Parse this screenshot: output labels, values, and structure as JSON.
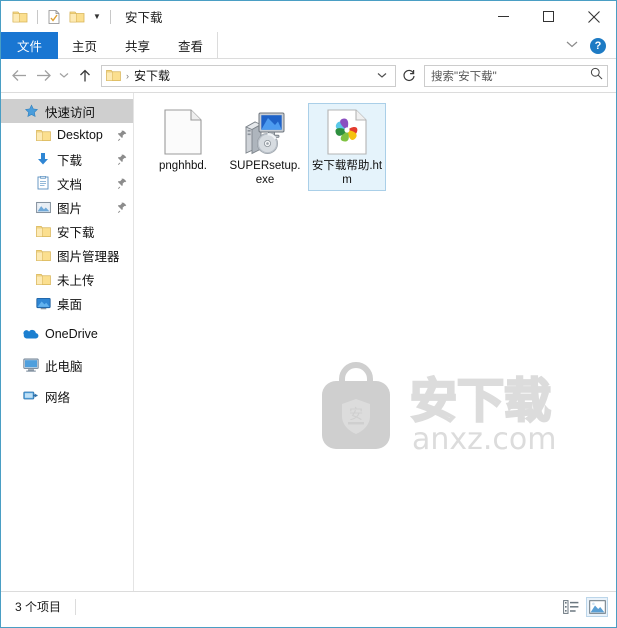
{
  "window": {
    "title": "安下载",
    "accent_blue": "#1976d2",
    "border_color": "#4a9ec4",
    "selection_bg": "#e5f3fb",
    "selection_border": "#aacfe8"
  },
  "quick_access_toolbar": {
    "items": [
      {
        "name": "folder-icon",
        "label": "属性"
      },
      {
        "name": "properties-icon",
        "label": "属性"
      },
      {
        "name": "new-folder-icon",
        "label": "新建文件夹"
      }
    ],
    "customize_label": "自定义快速访问工具栏"
  },
  "window_controls": {
    "minimize": "—",
    "maximize": "☐",
    "close": "✕"
  },
  "ribbon": {
    "tabs": [
      {
        "label": "文件",
        "active_style": "file"
      },
      {
        "label": "主页",
        "active_style": "normal"
      },
      {
        "label": "共享",
        "active_style": "normal"
      },
      {
        "label": "查看",
        "active_style": "normal"
      }
    ],
    "collapse_chevron": "⌄",
    "help_label": "?"
  },
  "addressbar": {
    "back": "←",
    "forward": "→",
    "recent": "⌄",
    "up": "↑",
    "breadcrumb_separator": "›",
    "breadcrumb": "安下载",
    "dropdown_chevron": "⌄",
    "refresh": "↻"
  },
  "search": {
    "placeholder": "搜索\"安下载\"",
    "icon": "⌕"
  },
  "sidebar": {
    "items": [
      {
        "label": "快速访问",
        "icon": "star-pin-icon",
        "indent": "lvl0",
        "selected": true,
        "pinned": false
      },
      {
        "label": "Desktop",
        "icon": "folder-icon",
        "indent": "lvl1",
        "selected": false,
        "pinned": true
      },
      {
        "label": "下载",
        "icon": "downloads-icon",
        "indent": "lvl1",
        "selected": false,
        "pinned": true
      },
      {
        "label": "文档",
        "icon": "documents-icon",
        "indent": "lvl1",
        "selected": false,
        "pinned": true
      },
      {
        "label": "图片",
        "icon": "pictures-icon",
        "indent": "lvl1",
        "selected": false,
        "pinned": true
      },
      {
        "label": "安下载",
        "icon": "folder-icon",
        "indent": "lvl1",
        "selected": false,
        "pinned": false
      },
      {
        "label": "图片管理器",
        "icon": "folder-icon",
        "indent": "lvl1",
        "selected": false,
        "pinned": false
      },
      {
        "label": "未上传",
        "icon": "folder-icon",
        "indent": "lvl1",
        "selected": false,
        "pinned": false
      },
      {
        "label": "桌面",
        "icon": "desktop-icon",
        "indent": "lvl1",
        "selected": false,
        "pinned": false
      },
      {
        "label": "OneDrive",
        "icon": "onedrive-icon",
        "indent": "lvl0",
        "selected": false,
        "pinned": false
      },
      {
        "label": "此电脑",
        "icon": "this-pc-icon",
        "indent": "lvl0",
        "selected": false,
        "pinned": false
      },
      {
        "label": "网络",
        "icon": "network-icon",
        "indent": "lvl0",
        "selected": false,
        "pinned": false
      }
    ]
  },
  "files": [
    {
      "name": "pnghhbd.",
      "icon": "blank-document-icon",
      "selected": false
    },
    {
      "name": "SUPERsetup.exe",
      "icon": "setup-exe-icon",
      "selected": false
    },
    {
      "name": "安下载帮助.htm",
      "icon": "html-pinwheel-icon",
      "selected": true
    }
  ],
  "watermark": {
    "brand": "安下载",
    "shield_char": "安",
    "domain": "anxz.com"
  },
  "statusbar": {
    "item_count": "3 个项目",
    "views": [
      {
        "name": "details-view-button",
        "active": false
      },
      {
        "name": "large-icons-view-button",
        "active": true
      }
    ]
  }
}
